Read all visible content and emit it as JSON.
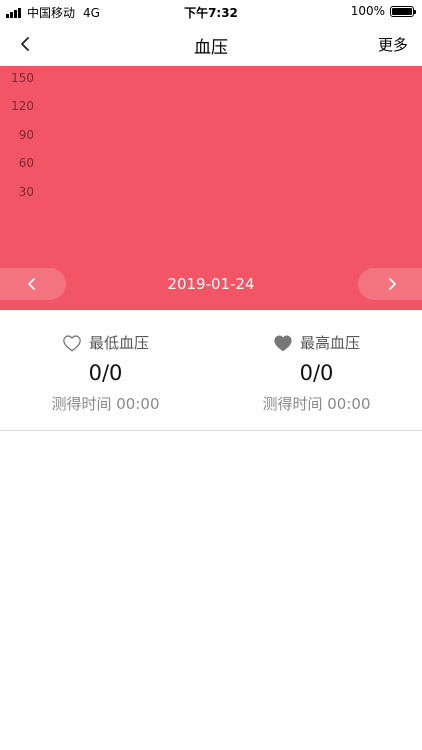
{
  "status_bar": {
    "carrier": "中国移动",
    "network": "4G",
    "time": "下午7:32",
    "battery": "100%"
  },
  "nav": {
    "title": "血压",
    "more_label": "更多"
  },
  "chart_data": {
    "type": "line",
    "title": "",
    "x": [],
    "series": [],
    "y_ticks": [
      "150",
      "120",
      "90",
      "60",
      "30"
    ],
    "ylim": [
      30,
      150
    ],
    "grid": false,
    "date": "2019-01-24"
  },
  "colors": {
    "chart_background": "#f25566",
    "text_muted": "#8a8a8a",
    "heart_fill": "#777777"
  },
  "stats": {
    "low": {
      "icon": "heart-outline-icon",
      "label": "最低血压",
      "value": "0/0",
      "time": "测得时间 00:00"
    },
    "high": {
      "icon": "heart-filled-icon",
      "label": "最高血压",
      "value": "0/0",
      "time": "测得时间 00:00"
    }
  }
}
